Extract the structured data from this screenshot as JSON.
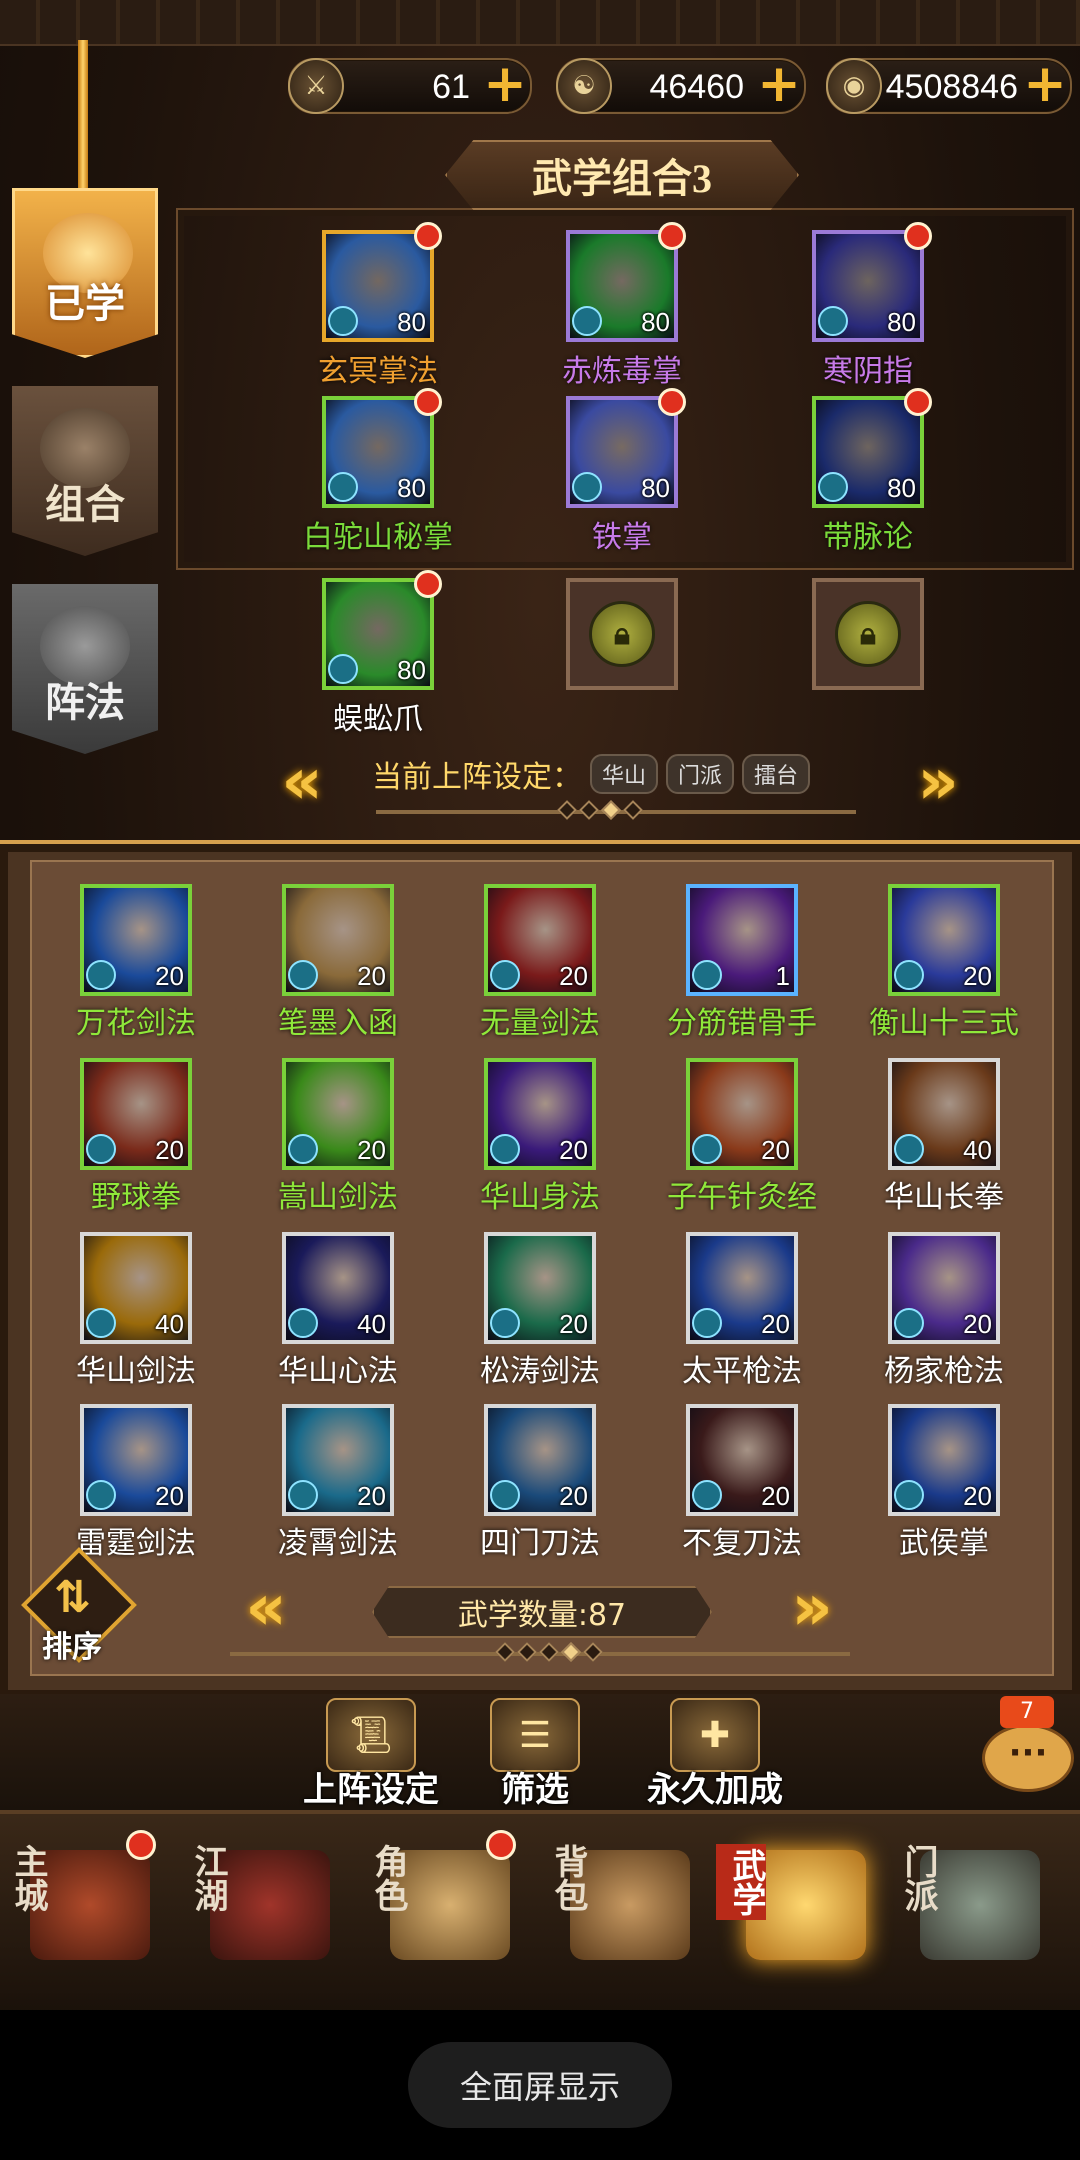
{
  "currency": [
    {
      "icon": "sword-token-icon",
      "value": "61"
    },
    {
      "icon": "yinyang-coin-icon",
      "value": "46460"
    },
    {
      "icon": "silver-coin-icon",
      "value": "4508846"
    }
  ],
  "left_tabs": [
    "已学",
    "组合",
    "阵法"
  ],
  "combo": {
    "title": "武学组合3",
    "skills": [
      {
        "name": "玄冥掌法",
        "level": "80",
        "color": "#f0a030"
      },
      {
        "name": "赤炼毒掌",
        "level": "80",
        "color": "#c77ae8"
      },
      {
        "name": "寒阴指",
        "level": "80",
        "color": "#c77ae8"
      },
      {
        "name": "白驼山秘掌",
        "level": "80",
        "color": "#7adb3a"
      },
      {
        "name": "铁掌",
        "level": "80",
        "color": "#c77ae8"
      },
      {
        "name": "带脉论",
        "level": "80",
        "color": "#7adb3a"
      },
      {
        "name": "蜈蚣爪",
        "level": "80",
        "color": "#ffffff"
      }
    ],
    "preset_label": "当前上阵设定：",
    "preset_chips": [
      "华山",
      "门派",
      "擂台"
    ]
  },
  "library": {
    "skills": [
      {
        "name": "万花剑法",
        "level": "20"
      },
      {
        "name": "笔墨入函",
        "level": "20"
      },
      {
        "name": "无量剑法",
        "level": "20"
      },
      {
        "name": "分筋错骨手",
        "level": "1"
      },
      {
        "name": "衡山十三式",
        "level": "20"
      },
      {
        "name": "野球拳",
        "level": "20"
      },
      {
        "name": "嵩山剑法",
        "level": "20"
      },
      {
        "name": "华山身法",
        "level": "20"
      },
      {
        "name": "子午针灸经",
        "level": "20"
      },
      {
        "name": "华山长拳",
        "level": "40"
      },
      {
        "name": "华山剑法",
        "level": "40"
      },
      {
        "name": "华山心法",
        "level": "40"
      },
      {
        "name": "松涛剑法",
        "level": "20"
      },
      {
        "name": "太平枪法",
        "level": "20"
      },
      {
        "name": "杨家枪法",
        "level": "20"
      },
      {
        "name": "雷霆剑法",
        "level": "20"
      },
      {
        "name": "凌霄剑法",
        "level": "20"
      },
      {
        "name": "四门刀法",
        "level": "20"
      },
      {
        "name": "不复刀法",
        "level": "20"
      },
      {
        "name": "武侯掌",
        "level": "20"
      }
    ],
    "count_label": "武学数量:87",
    "sort_label": "排序"
  },
  "actions": [
    "上阵设定",
    "筛选",
    "永久加成"
  ],
  "chat_badge": "7",
  "nav": [
    "主城",
    "江湖",
    "角色",
    "背包",
    "武学",
    "门派"
  ],
  "fullscreen_label": "全面屏显示"
}
